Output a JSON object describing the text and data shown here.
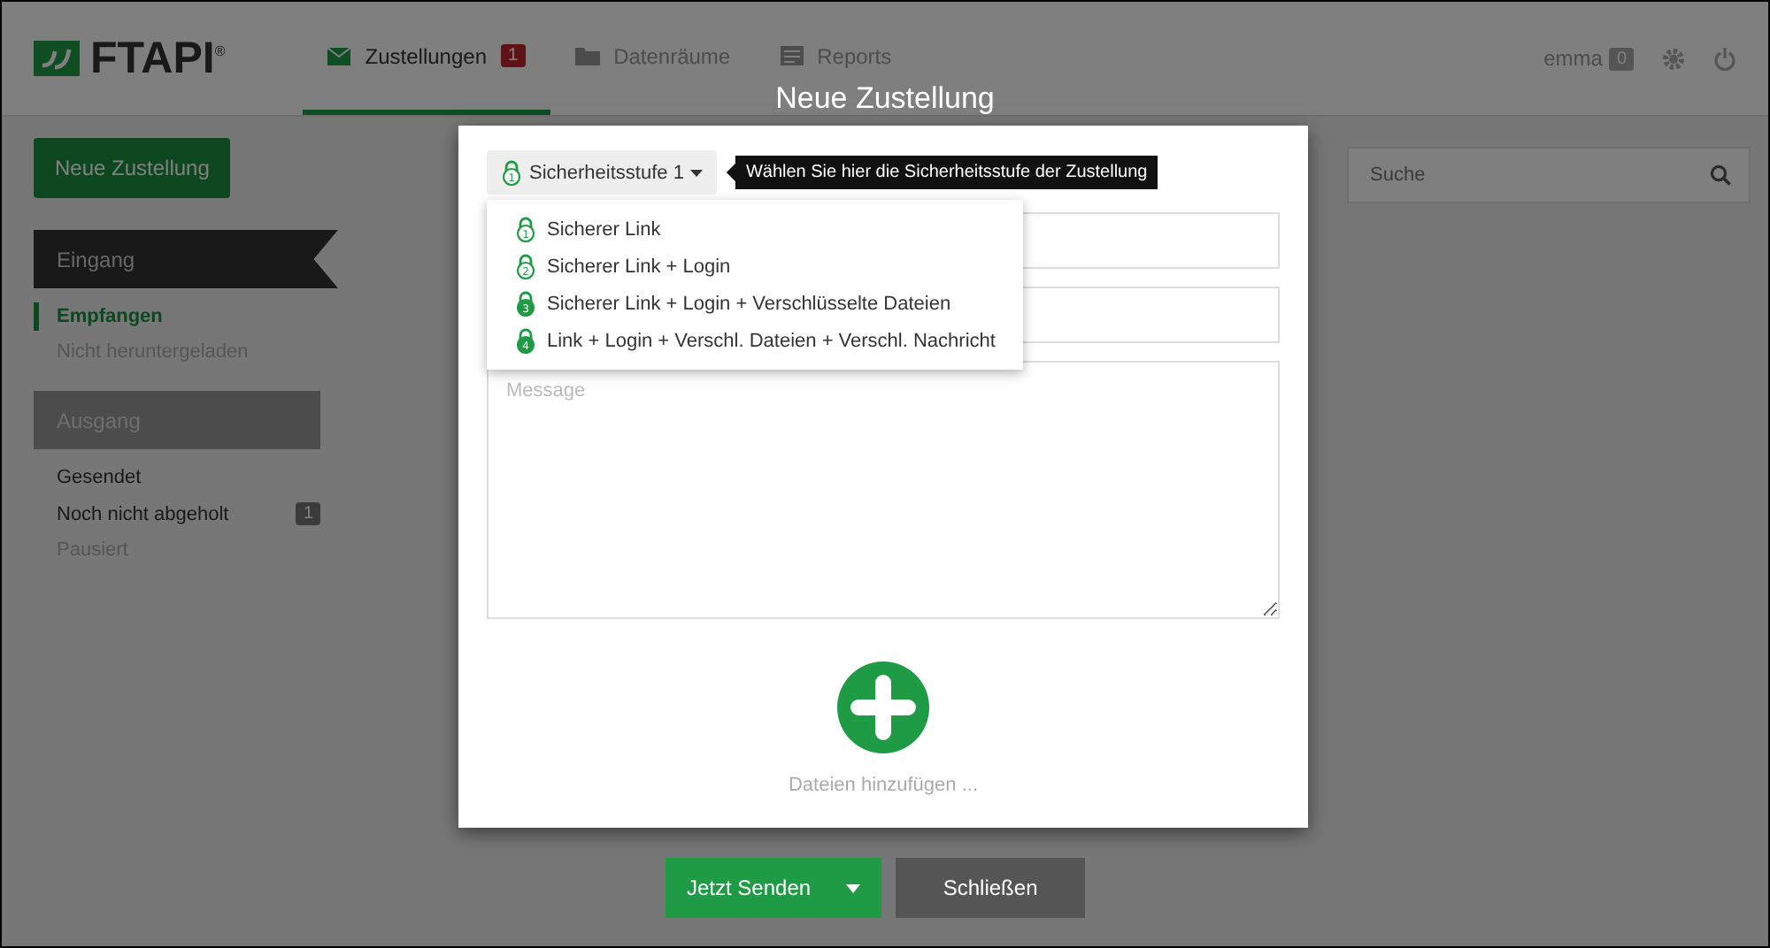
{
  "header": {
    "logo": "FTAPI",
    "logo_mark": "®",
    "tabs": [
      {
        "label": "Zustellungen",
        "selected": true,
        "badge": "1"
      },
      {
        "label": "Datenräume",
        "selected": false
      },
      {
        "label": "Reports",
        "selected": false
      }
    ],
    "user": "emma",
    "user_badge": "0"
  },
  "sidebar": {
    "new_button": "Neue Zustellung",
    "sections": [
      {
        "title": "Eingang",
        "selected": true,
        "items": [
          {
            "label": "Empfangen",
            "selected": true,
            "dimmed": false
          },
          {
            "label": "Nicht heruntergeladen",
            "selected": false,
            "dimmed": true
          }
        ]
      },
      {
        "title": "Ausgang",
        "selected": false,
        "items": [
          {
            "label": "Gesendet",
            "selected": false,
            "dimmed": false
          },
          {
            "label": "Noch nicht abgeholt",
            "selected": false,
            "dimmed": false,
            "badge": "1"
          },
          {
            "label": "Pausiert",
            "selected": false,
            "dimmed": true
          }
        ]
      }
    ]
  },
  "search": {
    "placeholder": "Suche"
  },
  "modal": {
    "title": "Neue Zustellung",
    "security_button": "Sicherheitsstufe 1",
    "security_number": "1",
    "tooltip": "Wählen Sie hier die Sicherheitsstufe der Zustellung",
    "security_options": [
      {
        "label": "Sicherer Link",
        "number": "1",
        "filled": false
      },
      {
        "label": "Sicherer Link + Login",
        "number": "2",
        "filled": false
      },
      {
        "label": "Sicherer Link + Login + Verschlüsselte Dateien",
        "number": "3",
        "filled": true
      },
      {
        "label": "Link + Login + Verschl. Dateien + Verschl. Nachricht",
        "number": "4",
        "filled": true
      }
    ],
    "message_placeholder": "Message",
    "add_files": "Dateien hinzufügen ...",
    "send_button": "Jetzt Senden",
    "close_button": "Schließen"
  }
}
